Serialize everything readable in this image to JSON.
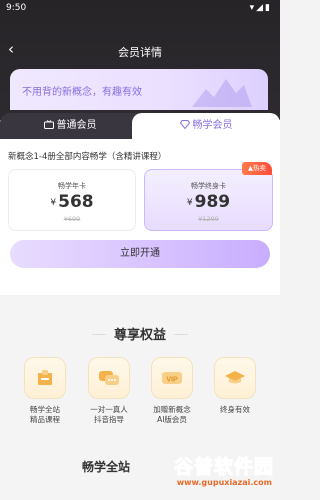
{
  "status": {
    "time": "9:50",
    "icons": "▾◢▮"
  },
  "nav": {
    "back_symbol": "‹",
    "title": "会员详情"
  },
  "banner": {
    "text": "不用背的新概念，有趣有效"
  },
  "tabs": [
    {
      "label": "普通会员",
      "icon": "tv-icon",
      "selected": false
    },
    {
      "label": "畅学会员",
      "icon": "diamond-icon",
      "selected": true
    }
  ],
  "description": "新概念1-4册全部内容畅学（含精讲课程）",
  "plans": [
    {
      "name": "畅学年卡",
      "currency": "¥",
      "price": "568",
      "original": "¥699",
      "selected": false,
      "badge": ""
    },
    {
      "name": "畅学终身卡",
      "currency": "¥",
      "price": "989",
      "original": "¥1299",
      "selected": true,
      "badge": "热卖"
    }
  ],
  "open_button": "立即开通",
  "benefits": {
    "title": "尊享权益",
    "items": [
      {
        "label": "畅学全站\n精品课程",
        "icon": "book-icon"
      },
      {
        "label": "一对一真人\n抖音指导",
        "icon": "chat-icon"
      },
      {
        "label": "加赠新概念\nAI版会员",
        "icon": "vip-icon"
      },
      {
        "label": "终身有效",
        "icon": "graduation-cap-icon"
      }
    ],
    "subtitle": "畅学全站"
  },
  "watermark": {
    "text": "谷普软件园",
    "url": "www.gupuxiazai.com"
  },
  "colors": {
    "accent": "#8a6ee0",
    "dark_bg": "#262427",
    "hot": "#ff4d3d"
  }
}
